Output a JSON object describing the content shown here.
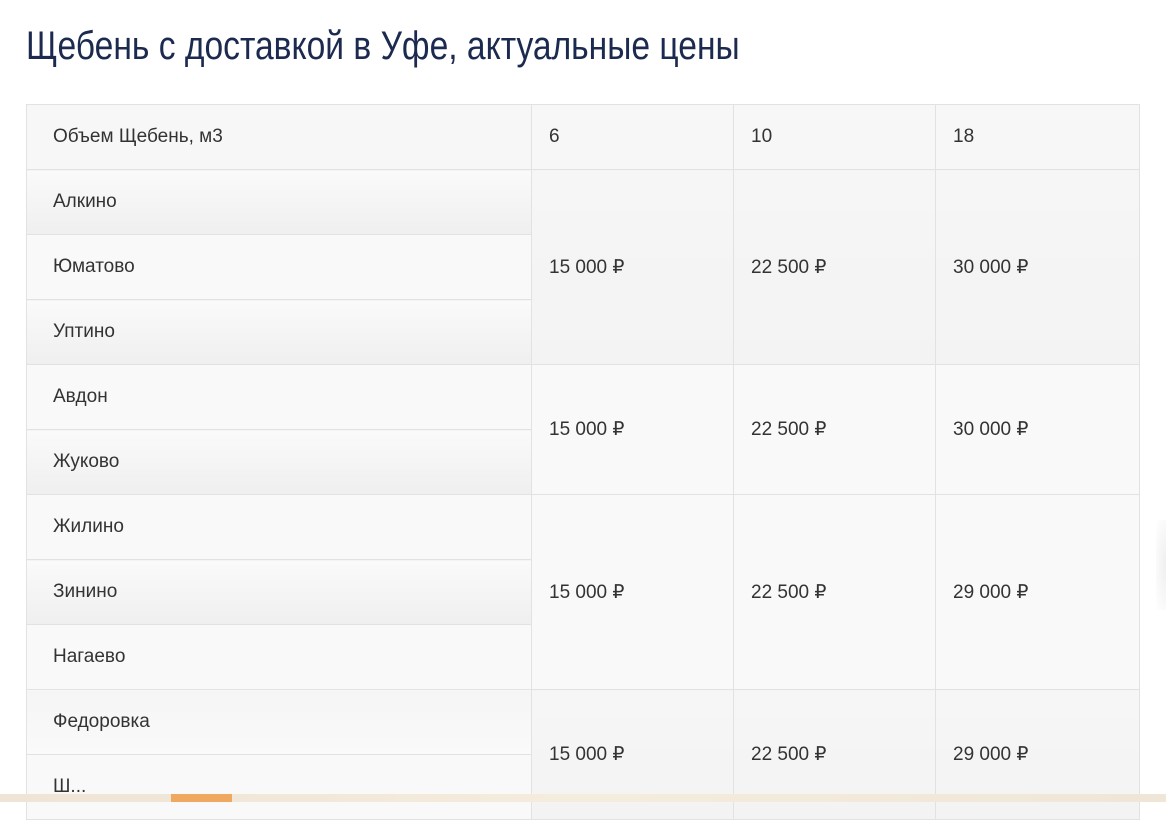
{
  "page": {
    "title": "Щебень с доставкой в Уфе, актуальные цены"
  },
  "table": {
    "header": [
      "Объем Щебень, м3",
      "6",
      "10",
      "18"
    ],
    "groups": [
      {
        "locations": [
          "Алкино",
          "Юматово",
          "Уптино"
        ],
        "prices": [
          "15 000 ₽",
          "22 500 ₽",
          "30 000 ₽"
        ]
      },
      {
        "locations": [
          "Авдон",
          "Жуково"
        ],
        "prices": [
          "15 000 ₽",
          "22 500 ₽",
          "30 000 ₽"
        ]
      },
      {
        "locations": [
          "Жилино",
          "Зинино",
          "Нагаево"
        ],
        "prices": [
          "15 000 ₽",
          "22 500 ₽",
          "29 000 ₽"
        ]
      },
      {
        "locations": [
          "Федоровка",
          "Ш..."
        ],
        "prices": [
          "15 000 ₽",
          "22 500 ₽",
          "29 000 ₽"
        ]
      }
    ]
  }
}
